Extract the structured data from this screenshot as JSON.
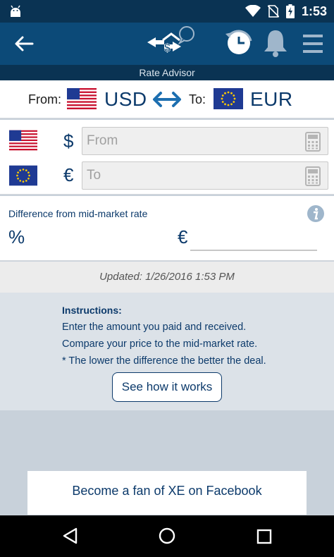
{
  "status_bar": {
    "time": "1:53"
  },
  "sub_header": {
    "title": "Rate Advisor"
  },
  "converter": {
    "from_label": "From:",
    "from_code": "USD",
    "to_label": "To:",
    "to_code": "EUR"
  },
  "inputs": {
    "from_symbol": "$",
    "from_placeholder": "From",
    "to_symbol": "€",
    "to_placeholder": "To"
  },
  "difference": {
    "title": "Difference from mid-market rate",
    "percent_symbol": "%",
    "currency_symbol": "€"
  },
  "updated": {
    "text": "Updated:  1/26/2016 1:53 PM"
  },
  "instructions": {
    "title": "Instructions:",
    "lines": [
      "Enter the amount you paid and received.",
      "Compare your price to the mid-market rate.",
      "* The lower the difference the better the deal."
    ],
    "button_label": "See how it works"
  },
  "facebook": {
    "label": "Become a fan of XE on Facebook"
  },
  "colors": {
    "app_bar": "#0c4a78",
    "status_bar": "#0a3353",
    "accent_text": "#0c3a6b",
    "background": "#c8d1da"
  }
}
